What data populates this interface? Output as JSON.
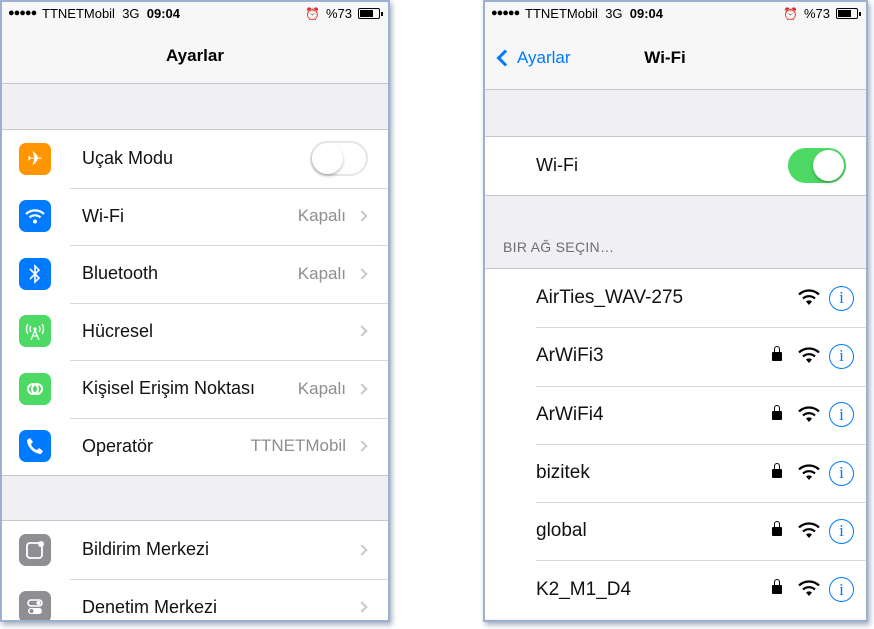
{
  "status_bar": {
    "signal_dots": "●●●●●",
    "carrier": "TTNETMobil",
    "network": "3G",
    "time": "09:04",
    "battery": "%73",
    "battery_level": 0.73
  },
  "left_screen": {
    "title": "Ayarlar",
    "group1": [
      {
        "label": "Uçak Modu",
        "icon": "airplane-icon",
        "color": "#ff9500",
        "glyph": "✈",
        "toggle": false
      },
      {
        "label": "Wi-Fi",
        "icon": "wifi-icon",
        "color": "#007aff",
        "value": "Kapalı"
      },
      {
        "label": "Bluetooth",
        "icon": "bluetooth-icon",
        "color": "#007aff",
        "value": "Kapalı"
      },
      {
        "label": "Hücresel",
        "icon": "cellular-icon",
        "color": "#4cd964",
        "value": ""
      },
      {
        "label": "Kişisel Erişim Noktası",
        "icon": "hotspot-icon",
        "color": "#4cd964",
        "value": "Kapalı"
      },
      {
        "label": "Operatör",
        "icon": "phone-icon",
        "color": "#007aff",
        "value": "TTNETMobil"
      }
    ],
    "group2": [
      {
        "label": "Bildirim Merkezi",
        "icon": "notification-center-icon",
        "color": "#8e8e93"
      },
      {
        "label": "Denetim Merkezi",
        "icon": "control-center-icon",
        "color": "#8e8e93"
      }
    ]
  },
  "right_screen": {
    "back_label": "Ayarlar",
    "title": "Wi-Fi",
    "wifi_label": "Wi-Fi",
    "wifi_on": true,
    "section_header": "BIR AĞ SEÇIN…",
    "networks": [
      {
        "name": "AirTies_WAV-275",
        "locked": false
      },
      {
        "name": "ArWiFi3",
        "locked": true
      },
      {
        "name": "ArWiFi4",
        "locked": true
      },
      {
        "name": "bizitek",
        "locked": true
      },
      {
        "name": "global",
        "locked": true
      },
      {
        "name": "K2_M1_D4",
        "locked": true
      }
    ],
    "info_glyph": "i"
  }
}
